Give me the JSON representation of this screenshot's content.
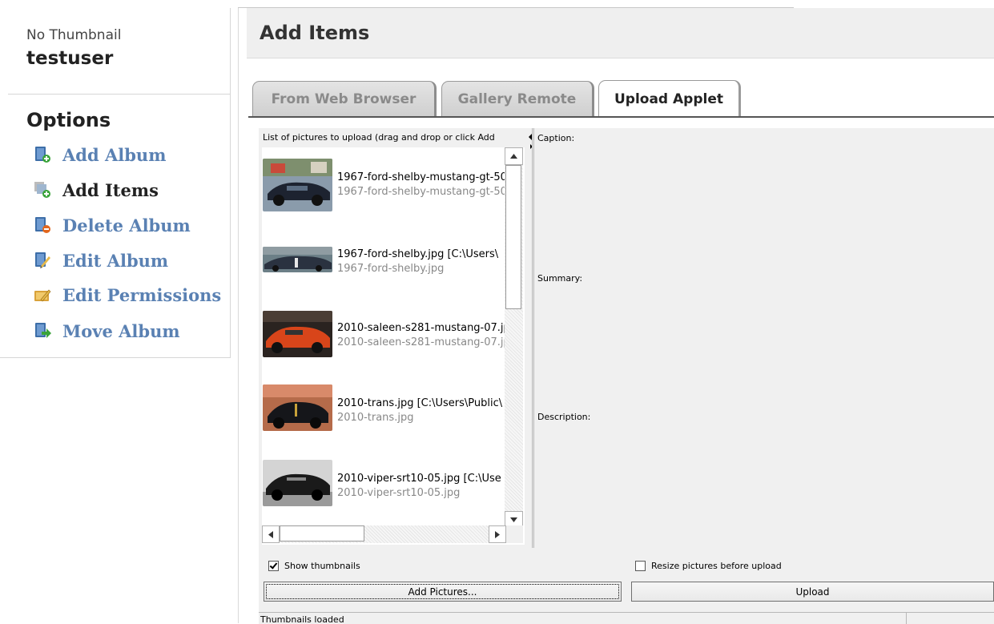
{
  "sidebar": {
    "thumbnail_label": "No Thumbnail",
    "username": "testuser",
    "options_title": "Options",
    "items": [
      {
        "label": "Add Album",
        "icon": "add-album-icon"
      },
      {
        "label": "Add Items",
        "icon": "add-items-icon",
        "current": true
      },
      {
        "label": "Delete Album",
        "icon": "delete-album-icon"
      },
      {
        "label": "Edit Album",
        "icon": "edit-album-icon"
      },
      {
        "label": "Edit Permissions",
        "icon": "edit-permissions-icon"
      },
      {
        "label": "Move Album",
        "icon": "move-album-icon"
      }
    ]
  },
  "main": {
    "title": "Add Items",
    "tabs": [
      {
        "label": "From Web Browser"
      },
      {
        "label": "Gallery Remote"
      },
      {
        "label": "Upload Applet",
        "active": true
      }
    ]
  },
  "applet": {
    "list_header": "List of pictures to upload (drag and drop or click Add",
    "files": [
      {
        "name": "1967-ford-shelby-mustang-gt-50",
        "sub": "1967-ford-shelby-mustang-gt-50"
      },
      {
        "name": "1967-ford-shelby.jpg [C:\\Users\\",
        "sub": "1967-ford-shelby.jpg"
      },
      {
        "name": "2010-saleen-s281-mustang-07.jp",
        "sub": "2010-saleen-s281-mustang-07.jp"
      },
      {
        "name": "2010-trans.jpg [C:\\Users\\Public\\",
        "sub": "2010-trans.jpg"
      },
      {
        "name": "2010-viper-srt10-05.jpg [C:\\Use",
        "sub": "2010-viper-srt10-05.jpg"
      }
    ],
    "caption_label": "Caption:",
    "summary_label": "Summary:",
    "description_label": "Description:",
    "show_thumbnails_label": "Show thumbnails",
    "show_thumbnails_checked": true,
    "resize_label": "Resize pictures before upload",
    "resize_checked": false,
    "add_pictures_label": "Add Pictures...",
    "upload_label": "Upload",
    "status": "Thumbnails loaded"
  },
  "colors": {
    "link": "#5a81b3",
    "header_bg": "#efefef"
  }
}
